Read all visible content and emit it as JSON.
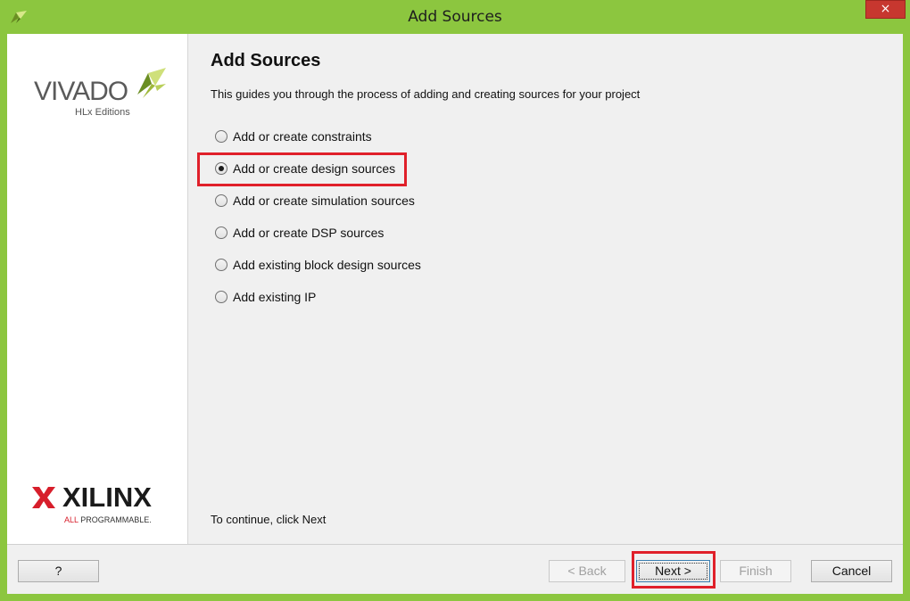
{
  "window": {
    "title": "Add Sources",
    "close_label": "×"
  },
  "sidebar": {
    "vivado_logo_text": "VIVADO",
    "vivado_edition": "HLx Editions",
    "xilinx_logo_text": "XILINX",
    "xilinx_tag_all": "ALL",
    "xilinx_tag_rest": "PROGRAMMABLE."
  },
  "content": {
    "heading": "Add Sources",
    "subtitle": "This guides you through the process of adding and creating sources for your project",
    "options": [
      {
        "label": "Add or create constraints",
        "checked": false
      },
      {
        "label": "Add or create design sources",
        "checked": true
      },
      {
        "label": "Add or create simulation sources",
        "checked": false
      },
      {
        "label": "Add or create DSP sources",
        "checked": false
      },
      {
        "label": "Add existing block design sources",
        "checked": false
      },
      {
        "label": "Add existing IP",
        "checked": false
      }
    ],
    "footer": "To continue, click Next"
  },
  "buttons": {
    "help": "?",
    "back": "< Back",
    "next": "Next >",
    "finish": "Finish",
    "cancel": "Cancel"
  },
  "colors": {
    "window_frame": "#8cc63f",
    "highlight": "#e0202a",
    "xilinx_red": "#d71e2b"
  }
}
